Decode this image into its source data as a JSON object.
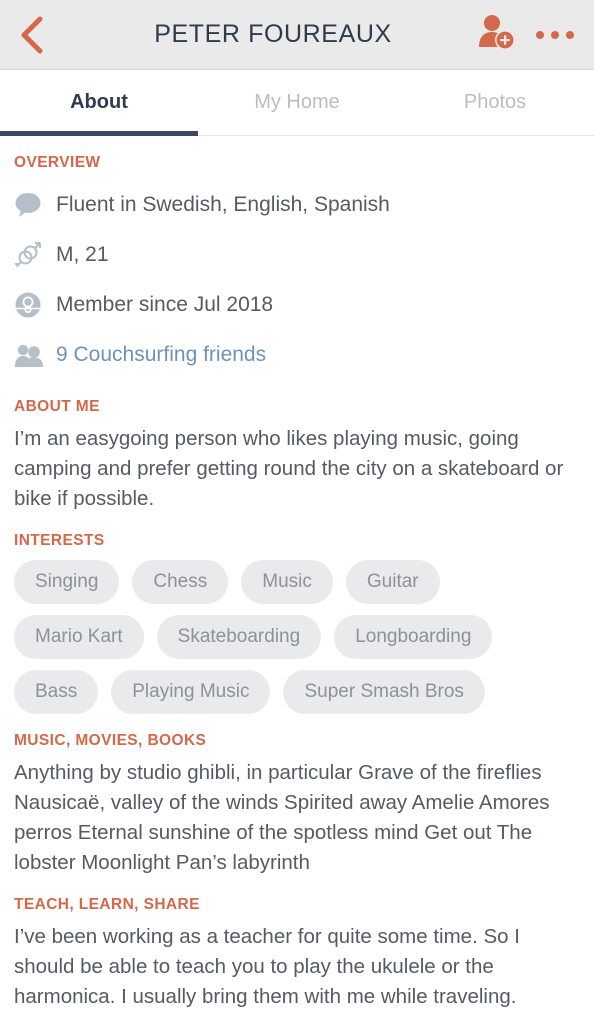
{
  "header": {
    "title": "PETER FOUREAUX",
    "back_icon": "chevron-left-icon",
    "add_friend_icon": "add-friend-icon",
    "more_icon": "more-options-icon",
    "accent_color": "#d4684a",
    "background": "#eaeaea",
    "title_color": "#2e3b4e"
  },
  "tabs": {
    "items": [
      {
        "label": "About",
        "active": true
      },
      {
        "label": "My Home",
        "active": false
      },
      {
        "label": "Photos",
        "active": false
      }
    ],
    "indicator_color": "#3b4a5f",
    "inactive_color": "#bdbdbd"
  },
  "sections": {
    "overview": {
      "title": "OVERVIEW",
      "rows": [
        {
          "icon": "speech-bubble-icon",
          "text": "Fluent in Swedish, English, Spanish",
          "is_link": false
        },
        {
          "icon": "gender-icon",
          "text": "M, 21",
          "is_link": false
        },
        {
          "icon": "member-badge-icon",
          "text": "Member since Jul 2018",
          "is_link": false
        },
        {
          "icon": "friends-icon",
          "text": "9 Couchsurfing friends",
          "is_link": true
        }
      ]
    },
    "about_me": {
      "title": "ABOUT ME",
      "body": "I’m an easygoing person who likes playing music, going camping and prefer getting round the city on a skateboard or bike if possible."
    },
    "interests": {
      "title": "INTERESTS",
      "tags": [
        "Singing",
        "Chess",
        "Music",
        "Guitar",
        "Mario Kart",
        "Skateboarding",
        "Longboarding",
        "Bass",
        "Playing Music",
        "Super Smash Bros"
      ]
    },
    "music_movies_books": {
      "title": "MUSIC, MOVIES, BOOKS",
      "body": "Anything by studio ghibli, in particular Grave of the fireflies Nausicaë, valley of the winds Spirited away Amelie Amores perros Eternal sunshine of the spotless mind Get out The lobster Moonlight Pan’s labyrinth"
    },
    "teach_learn_share": {
      "title": "TEACH, LEARN, SHARE",
      "body": "I’ve been working as a teacher for quite some time. So I should be able to teach you to play the ukulele or the harmonica. I usually bring them with me while traveling."
    }
  },
  "colors": {
    "section_heading": "#d4684a",
    "body_text": "#555b63",
    "link": "#6f93b8",
    "tag_background": "#e8eaec",
    "tag_text": "#8b929b",
    "icon_gray": "#b6bec9"
  }
}
